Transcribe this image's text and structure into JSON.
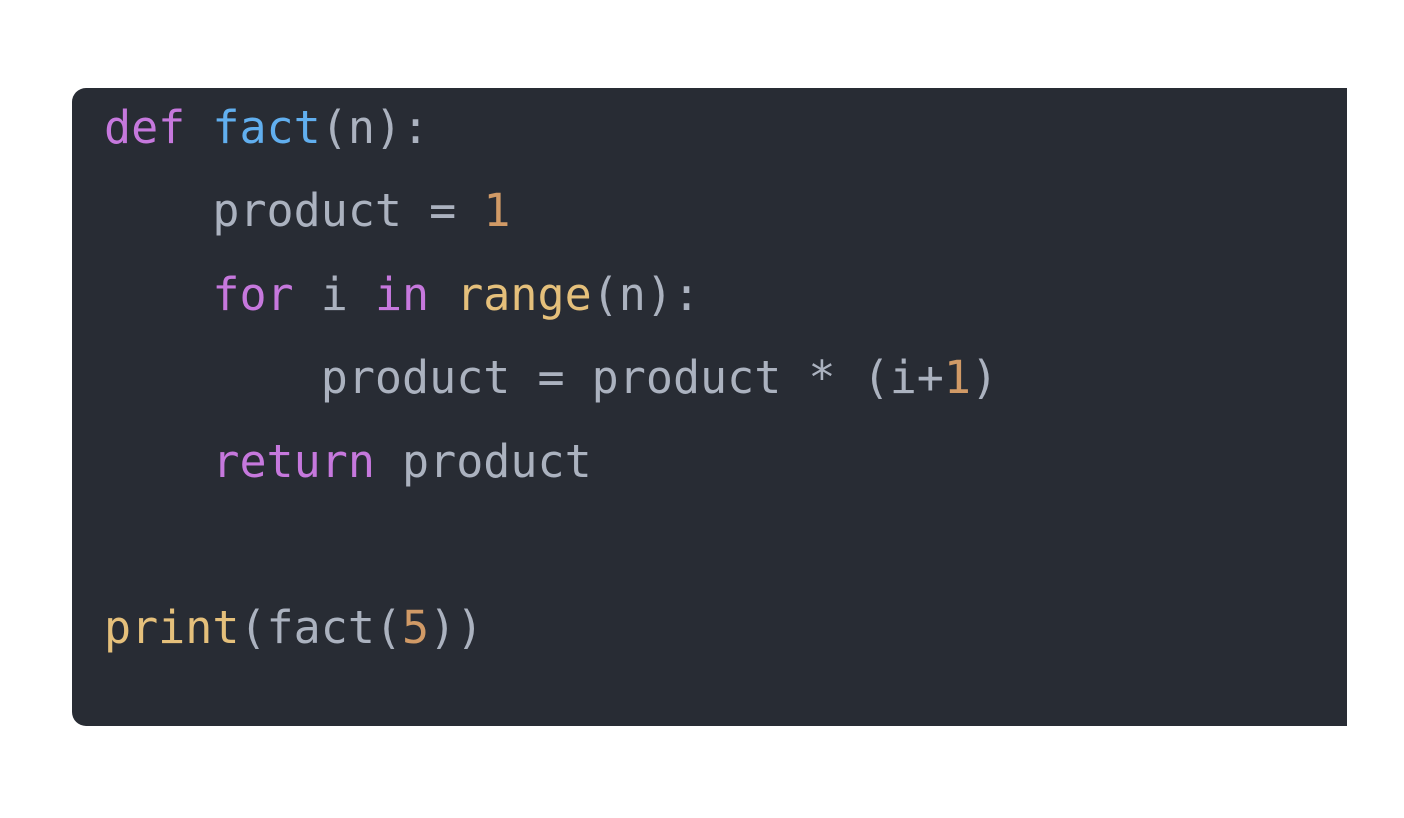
{
  "colors": {
    "background": "#ffffff",
    "code_background": "#282c34",
    "keyword": "#c678dd",
    "function": "#61afef",
    "builtin": "#e5c07b",
    "number": "#d19a66",
    "plain": "#abb2bf"
  },
  "code": {
    "language": "python",
    "lines": [
      {
        "indent": "",
        "tokens": [
          {
            "t": "def",
            "k": "kw"
          },
          {
            "t": " ",
            "k": "plain"
          },
          {
            "t": "fact",
            "k": "fn"
          },
          {
            "t": "(n):",
            "k": "plain"
          }
        ]
      },
      {
        "indent": "    ",
        "tokens": [
          {
            "t": "product = ",
            "k": "plain"
          },
          {
            "t": "1",
            "k": "num"
          }
        ]
      },
      {
        "indent": "    ",
        "tokens": [
          {
            "t": "for",
            "k": "kw"
          },
          {
            "t": " i ",
            "k": "plain"
          },
          {
            "t": "in",
            "k": "kw"
          },
          {
            "t": " ",
            "k": "plain"
          },
          {
            "t": "range",
            "k": "bi"
          },
          {
            "t": "(n):",
            "k": "plain"
          }
        ]
      },
      {
        "indent": "        ",
        "tokens": [
          {
            "t": "product = product * (i+",
            "k": "plain"
          },
          {
            "t": "1",
            "k": "num"
          },
          {
            "t": ")",
            "k": "plain"
          }
        ]
      },
      {
        "indent": "    ",
        "tokens": [
          {
            "t": "return",
            "k": "kw"
          },
          {
            "t": " product",
            "k": "plain"
          }
        ]
      },
      {
        "indent": "",
        "tokens": []
      },
      {
        "indent": "",
        "tokens": [
          {
            "t": "print",
            "k": "bi"
          },
          {
            "t": "(fact(",
            "k": "plain"
          },
          {
            "t": "5",
            "k": "num"
          },
          {
            "t": "))",
            "k": "plain"
          }
        ]
      }
    ]
  }
}
